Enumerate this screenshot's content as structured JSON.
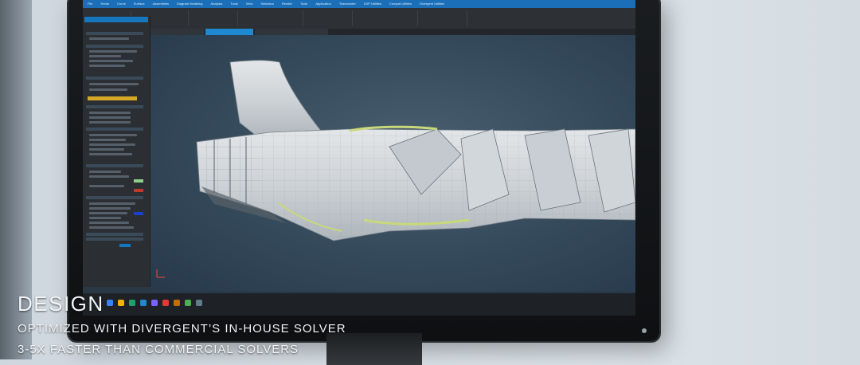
{
  "caption": {
    "heading": "DESIGN",
    "line1": "OPTIMIZED WITH DIVERGENT’S IN-HOUSE SOLVER",
    "line2": "3-5X FASTER THAN COMMERCIAL SOLVERS"
  },
  "screen": {
    "menus": [
      "File",
      "Home",
      "Curve",
      "Surface",
      "Assemblies",
      "Diagram Modeling",
      "Analysis",
      "Tools",
      "View",
      "Selection",
      "Render",
      "Tools",
      "Application",
      "Teamcenter",
      "DXP Utilities",
      "Compat Utilities",
      "Divergent Utilities"
    ]
  },
  "colors": {
    "screen_bg": "#2a3744",
    "accent_blue": "#1a6fb8",
    "highlight_yellow": "#d7a826",
    "model_surface": "#d9dde1",
    "model_accent": "#c9d97a"
  }
}
